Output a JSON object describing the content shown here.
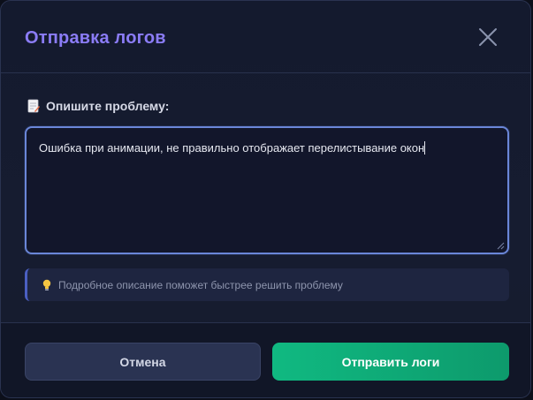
{
  "dialog": {
    "title": "Отправка логов",
    "close_icon": "close-icon"
  },
  "form": {
    "label": "Опишите проблему:",
    "label_icon": "memo-icon",
    "textarea_value": "Ошибка при анимации, не правильно отображает перелистывание окон",
    "hint_icon": "lightbulb-icon",
    "hint_text": "Подробное описание поможет быстрее решить проблему"
  },
  "footer": {
    "cancel_label": "Отмена",
    "send_label": "Отправить логи"
  },
  "colors": {
    "accent": "#8b7cf6",
    "send_button": "#10b981",
    "focus_border": "#6a86d8"
  }
}
